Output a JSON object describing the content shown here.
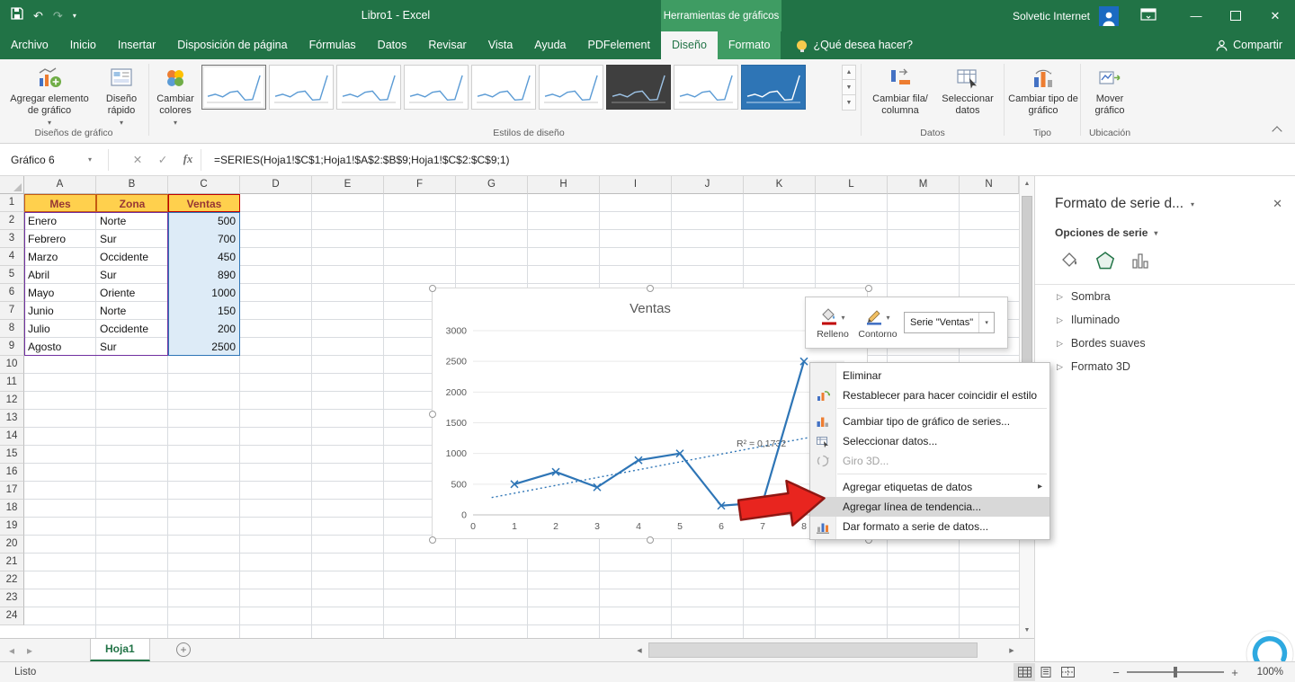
{
  "colors": {
    "excel_green": "#217346",
    "contextual_green": "#3F9C63",
    "chart_blue": "#2E75B6",
    "header_fill_yellow": "#FFD04D",
    "range_purple": "#7030A0",
    "values_fill_blue": "#DDEBF7",
    "arrow_red": "#E8251F",
    "menu_highlight": "#D8D8D8"
  },
  "icons": {
    "undo": "↶",
    "redo": "↷",
    "dropdown": "▾",
    "close": "✕",
    "check": "✓",
    "cancel": "✕",
    "fx": "fx",
    "minimize": "—",
    "up_arrow": "▲",
    "down_arrow": "▼",
    "left_arrow": "◀",
    "right_arrow": "▶",
    "tab_left": "◂",
    "tab_right": "▸",
    "submenu": "▸",
    "expand_triangle": "▷",
    "minus": "−",
    "plus": "+",
    "gallery_more": "▼"
  },
  "titlebar": {
    "title": "Libro1 - Excel",
    "context_tools": "Herramientas de gráficos",
    "user": "Solvetic Internet"
  },
  "ribbon_tabs": [
    {
      "label": "Archivo"
    },
    {
      "label": "Inicio"
    },
    {
      "label": "Insertar"
    },
    {
      "label": "Disposición de página"
    },
    {
      "label": "Fórmulas"
    },
    {
      "label": "Datos"
    },
    {
      "label": "Revisar"
    },
    {
      "label": "Vista"
    },
    {
      "label": "Ayuda"
    },
    {
      "label": "PDFelement"
    },
    {
      "label": "Diseño",
      "active": true,
      "contextual": true
    },
    {
      "label": "Formato",
      "contextual": true
    }
  ],
  "ribbon_right": {
    "tell_me": "¿Qué desea hacer?",
    "share": "Compartir"
  },
  "ribbon_groups": {
    "layouts": {
      "label": "Diseños de gráfico",
      "add_element": "Agregar elemento de gráfico",
      "quick_layout": "Diseño rápido"
    },
    "styles": {
      "label": "Estilos de diseño",
      "change_colors": "Cambiar colores",
      "gallery": [
        "selected",
        "plain",
        "plain",
        "plain",
        "plain",
        "plain",
        "dark",
        "plain",
        "blue"
      ]
    },
    "data": {
      "label": "Datos",
      "switch_rc": "Cambiar fila/ columna",
      "select_data": "Seleccionar datos"
    },
    "type": {
      "label": "Tipo",
      "change_type": "Cambiar tipo de gráfico"
    },
    "location": {
      "label": "Ubicación",
      "move_chart": "Mover gráfico"
    }
  },
  "formula_bar": {
    "name_box": "Gráfico 6",
    "formula": "=SERIES(Hoja1!$C$1;Hoja1!$A$2:$B$9;Hoja1!$C$2:$C$9;1)"
  },
  "sheet": {
    "columns": [
      "A",
      "B",
      "C",
      "D",
      "E",
      "F",
      "G",
      "H",
      "I",
      "J",
      "K",
      "L",
      "M",
      "N"
    ],
    "rows": 24,
    "table": {
      "headers": [
        "Mes",
        "Zona",
        "Ventas"
      ],
      "rows": [
        [
          "Enero",
          "Norte",
          "500"
        ],
        [
          "Febrero",
          "Sur",
          "700"
        ],
        [
          "Marzo",
          "Occidente",
          "450"
        ],
        [
          "Abril",
          "Sur",
          "890"
        ],
        [
          "Mayo",
          "Oriente",
          "1000"
        ],
        [
          "Junio",
          "Norte",
          "150"
        ],
        [
          "Julio",
          "Occidente",
          "200"
        ],
        [
          "Agosto",
          "Sur",
          "2500"
        ]
      ]
    }
  },
  "chart_data": {
    "type": "line",
    "title": "Ventas",
    "x": [
      1,
      2,
      3,
      4,
      5,
      6,
      7,
      8
    ],
    "x_axis_ticks": [
      0,
      1,
      2,
      3,
      4,
      5,
      6,
      7,
      8
    ],
    "series": [
      {
        "name": "Ventas",
        "values": [
          500,
          700,
          450,
          890,
          1000,
          150,
          200,
          2500
        ]
      }
    ],
    "y_ticks": [
      0,
      500,
      1000,
      1500,
      2000,
      2500,
      3000
    ],
    "ylim": [
      0,
      3000
    ],
    "grid": true,
    "legend": "none",
    "trendline": {
      "type": "linear",
      "style": "dotted",
      "label": "R² = 0,1732"
    }
  },
  "mini_toolbar": {
    "fill": "Relleno",
    "outline": "Contorno",
    "series_box": "Serie \"Ventas\""
  },
  "context_menu": {
    "items": [
      {
        "label": "Eliminar"
      },
      {
        "label": "Restablecer para hacer coincidir el estilo",
        "icon": "reset-style-icon"
      },
      {
        "separator": true
      },
      {
        "label": "Cambiar tipo de gráfico de series...",
        "icon": "chart-type-icon"
      },
      {
        "label": "Seleccionar datos...",
        "icon": "select-data-icon"
      },
      {
        "label": "Giro 3D...",
        "icon": "rotation-3d-icon",
        "disabled": true
      },
      {
        "separator": true
      },
      {
        "label": "Agregar etiquetas de datos",
        "submenu": true
      },
      {
        "label": "Agregar línea de tendencia...",
        "highlighted": true
      },
      {
        "label": "Dar formato a serie de datos...",
        "icon": "format-series-icon"
      }
    ]
  },
  "format_pane": {
    "title": "Formato de serie d...",
    "options_label": "Opciones de serie",
    "sections": [
      "Sombra",
      "Iluminado",
      "Bordes suaves",
      "Formato 3D"
    ]
  },
  "sheet_tabs": {
    "active": "Hoja1"
  },
  "status_bar": {
    "ready": "Listo",
    "zoom": "100%"
  }
}
